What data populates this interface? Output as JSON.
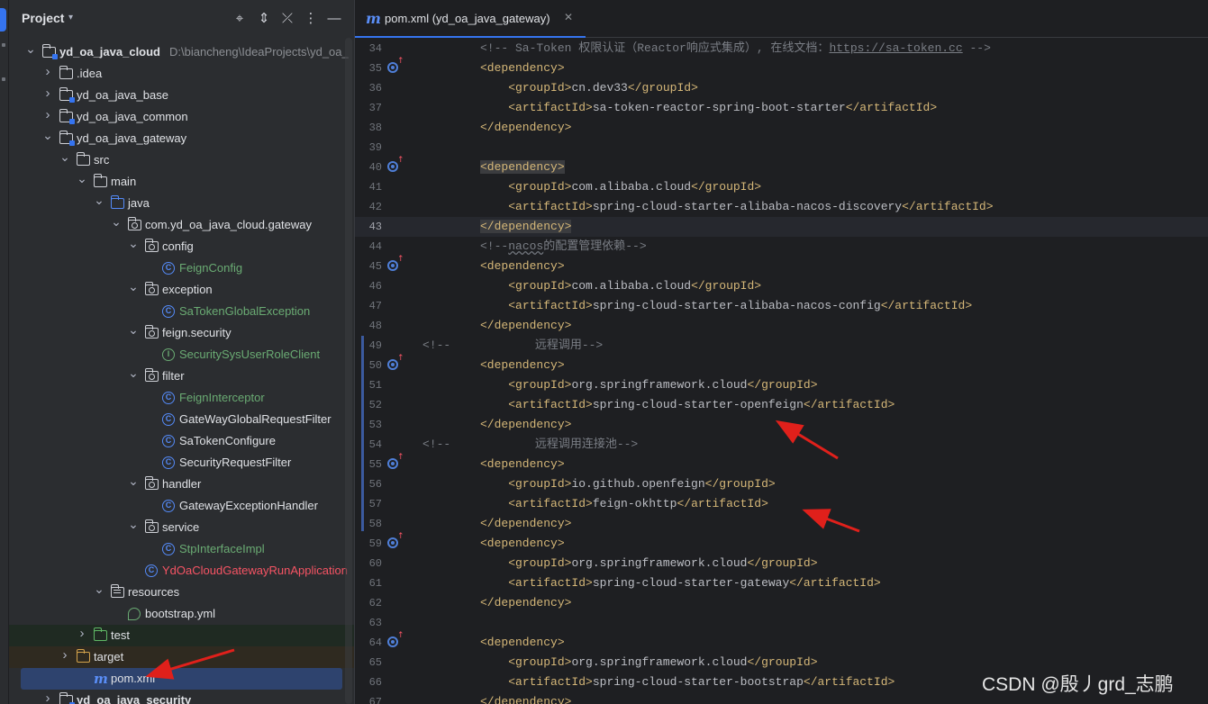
{
  "project_panel": {
    "title": "Project",
    "chevron": "⌄",
    "header_buttons": [
      {
        "name": "locate-icon",
        "glyph": "⌖"
      },
      {
        "name": "expand-all-icon",
        "glyph": "⇅"
      },
      {
        "name": "collapse-all-icon",
        "glyph": "⤡"
      },
      {
        "name": "options-icon",
        "glyph": "⋮"
      },
      {
        "name": "hide-icon",
        "glyph": "—"
      }
    ]
  },
  "tree": [
    {
      "label": "yd_oa_java_cloud",
      "path": "D:\\biancheng\\IdeaProjects\\yd_oa_",
      "icon": "module-folder-icon",
      "bold": true,
      "chevron": "v"
    },
    {
      "label": ".idea",
      "icon": "folder-icon",
      "chevron": ">"
    },
    {
      "label": "yd_oa_java_base",
      "icon": "module-folder-icon",
      "chevron": ">"
    },
    {
      "label": "yd_oa_java_common",
      "icon": "module-folder-icon",
      "chevron": ">"
    },
    {
      "label": "yd_oa_java_gateway",
      "icon": "module-folder-icon",
      "chevron": "v"
    },
    {
      "label": "src",
      "icon": "folder-icon",
      "chevron": "v"
    },
    {
      "label": "main",
      "icon": "folder-icon",
      "chevron": "v"
    },
    {
      "label": "java",
      "icon": "source-folder-icon",
      "chevron": "v"
    },
    {
      "label": "com.yd_oa_java_cloud.gateway",
      "icon": "package-icon",
      "chevron": "v"
    },
    {
      "label": "config",
      "icon": "package-icon",
      "chevron": "v"
    },
    {
      "label": "FeignConfig",
      "icon": "class-icon",
      "color": "green"
    },
    {
      "label": "exception",
      "icon": "package-icon",
      "chevron": "v"
    },
    {
      "label": "SaTokenGlobalException",
      "icon": "class-icon",
      "color": "green"
    },
    {
      "label": "feign.security",
      "icon": "package-icon",
      "chevron": "v"
    },
    {
      "label": "SecuritySysUserRoleClient",
      "icon": "interface-icon",
      "color": "green"
    },
    {
      "label": "filter",
      "icon": "package-icon",
      "chevron": "v"
    },
    {
      "label": "FeignInterceptor",
      "icon": "class-icon",
      "color": "green"
    },
    {
      "label": "GateWayGlobalRequestFilter",
      "icon": "class-icon"
    },
    {
      "label": "SaTokenConfigure",
      "icon": "class-icon"
    },
    {
      "label": "SecurityRequestFilter",
      "icon": "class-icon"
    },
    {
      "label": "handler",
      "icon": "package-icon",
      "chevron": "v"
    },
    {
      "label": "GatewayExceptionHandler",
      "icon": "class-icon"
    },
    {
      "label": "service",
      "icon": "package-icon",
      "chevron": "v"
    },
    {
      "label": "StpInterfaceImpl",
      "icon": "class-icon",
      "color": "green"
    },
    {
      "label": "YdOaCloudGatewayRunApplication",
      "icon": "spring-class-icon",
      "color": "red"
    },
    {
      "label": "resources",
      "icon": "resources-folder-icon",
      "chevron": "v"
    },
    {
      "label": "bootstrap.yml",
      "icon": "yml-icon"
    },
    {
      "label": "test",
      "icon": "test-folder-icon",
      "chevron": ">"
    },
    {
      "label": "target",
      "icon": "excluded-folder-icon",
      "chevron": ">"
    },
    {
      "label": "pom.xml",
      "icon": "maven-icon",
      "selected": true
    },
    {
      "label": "yd_oa_java_security",
      "icon": "module-folder-icon",
      "chevron": ">",
      "bold": true
    }
  ],
  "editor": {
    "tab": {
      "label": "pom.xml (yd_oa_java_gateway)",
      "close": "✕",
      "icon": "m"
    },
    "current_line": 43,
    "gutter_marker_lines": [
      35,
      40,
      45,
      50,
      55,
      59,
      64
    ],
    "lines": [
      {
        "n": 34,
        "text": "<!-- Sa-Token 权限认证（Reactor响应式集成）, 在线文档：https://sa-token.cc -->"
      },
      {
        "n": 35,
        "text": "<dependency>"
      },
      {
        "n": 36,
        "text": "    <groupId>cn.dev33</groupId>"
      },
      {
        "n": 37,
        "text": "    <artifactId>sa-token-reactor-spring-boot-starter</artifactId>"
      },
      {
        "n": 38,
        "text": "</dependency>"
      },
      {
        "n": 39,
        "text": ""
      },
      {
        "n": 40,
        "text": "<dependency>"
      },
      {
        "n": 41,
        "text": "    <groupId>com.alibaba.cloud</groupId>"
      },
      {
        "n": 42,
        "text": "    <artifactId>spring-cloud-starter-alibaba-nacos-discovery</artifactId>"
      },
      {
        "n": 43,
        "text": "</dependency>"
      },
      {
        "n": 44,
        "text": "<!--nacos的配置管理依赖-->"
      },
      {
        "n": 45,
        "text": "<dependency>"
      },
      {
        "n": 46,
        "text": "    <groupId>com.alibaba.cloud</groupId>"
      },
      {
        "n": 47,
        "text": "    <artifactId>spring-cloud-starter-alibaba-nacos-config</artifactId>"
      },
      {
        "n": 48,
        "text": "</dependency>"
      },
      {
        "n": 49,
        "text": "<!--            远程调用-->"
      },
      {
        "n": 50,
        "text": "<dependency>"
      },
      {
        "n": 51,
        "text": "    <groupId>org.springframework.cloud</groupId>"
      },
      {
        "n": 52,
        "text": "    <artifactId>spring-cloud-starter-openfeign</artifactId>"
      },
      {
        "n": 53,
        "text": "</dependency>"
      },
      {
        "n": 54,
        "text": "<!--            远程调用连接池-->"
      },
      {
        "n": 55,
        "text": "<dependency>"
      },
      {
        "n": 56,
        "text": "    <groupId>io.github.openfeign</groupId>"
      },
      {
        "n": 57,
        "text": "    <artifactId>feign-okhttp</artifactId>"
      },
      {
        "n": 58,
        "text": "</dependency>"
      },
      {
        "n": 59,
        "text": "<dependency>"
      },
      {
        "n": 60,
        "text": "    <groupId>org.springframework.cloud</groupId>"
      },
      {
        "n": 61,
        "text": "    <artifactId>spring-cloud-starter-gateway</artifactId>"
      },
      {
        "n": 62,
        "text": "</dependency>"
      },
      {
        "n": 63,
        "text": ""
      },
      {
        "n": 64,
        "text": "<dependency>"
      },
      {
        "n": 65,
        "text": "    <groupId>org.springframework.cloud</groupId>"
      },
      {
        "n": 66,
        "text": "    <artifactId>spring-cloud-starter-bootstrap</artifactId>"
      },
      {
        "n": 67,
        "text": "</dependency>"
      }
    ]
  },
  "watermark": "CSDN @殷丿grd_志鹏",
  "colors": {
    "tag": "#d5b778",
    "comment": "#7a7e85",
    "selection": "#2e436e",
    "annotation_arrow": "#e0201b"
  }
}
